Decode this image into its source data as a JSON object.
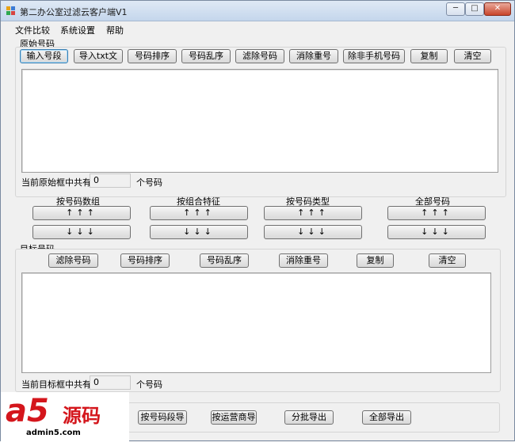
{
  "window": {
    "title": "第二办公室过滤云客户端V1",
    "caption": {
      "minimize": "─",
      "maximize": "□",
      "close": "✕"
    }
  },
  "menu": [
    "文件比较",
    "系统设置",
    "帮助"
  ],
  "source": {
    "group_label": "原始号码",
    "buttons": [
      "输入号段",
      "导入txt文",
      "号码排序",
      "号码乱序",
      "滤除号码",
      "消除重号",
      "除非手机号码",
      "复制",
      "清空"
    ],
    "count_prefix": "当前原始框中共有",
    "count_value": "0",
    "count_suffix": "个号码"
  },
  "transfer": {
    "columns": [
      "按号码数组",
      "按组合特征",
      "按号码类型",
      "全部号码"
    ],
    "up_label": "↑↑↑",
    "down_label": "↓↓↓"
  },
  "target": {
    "group_label": "目标号码",
    "buttons": [
      "滤除号码",
      "号码排序",
      "号码乱序",
      "消除重号",
      "复制",
      "清空"
    ],
    "count_prefix": "当前目标框中共有",
    "count_value": "0",
    "count_suffix": "个号码"
  },
  "export": {
    "buttons": [
      "按号码段导",
      "按运营商导",
      "分批导出",
      "全部导出"
    ]
  },
  "watermark": {
    "logo": "a5",
    "text": "源码",
    "url": "admin5.com"
  },
  "colors": {
    "title_gradient_top": "#dfe9f5",
    "close_red": "#c9452b",
    "watermark_red": "#d4161c"
  }
}
